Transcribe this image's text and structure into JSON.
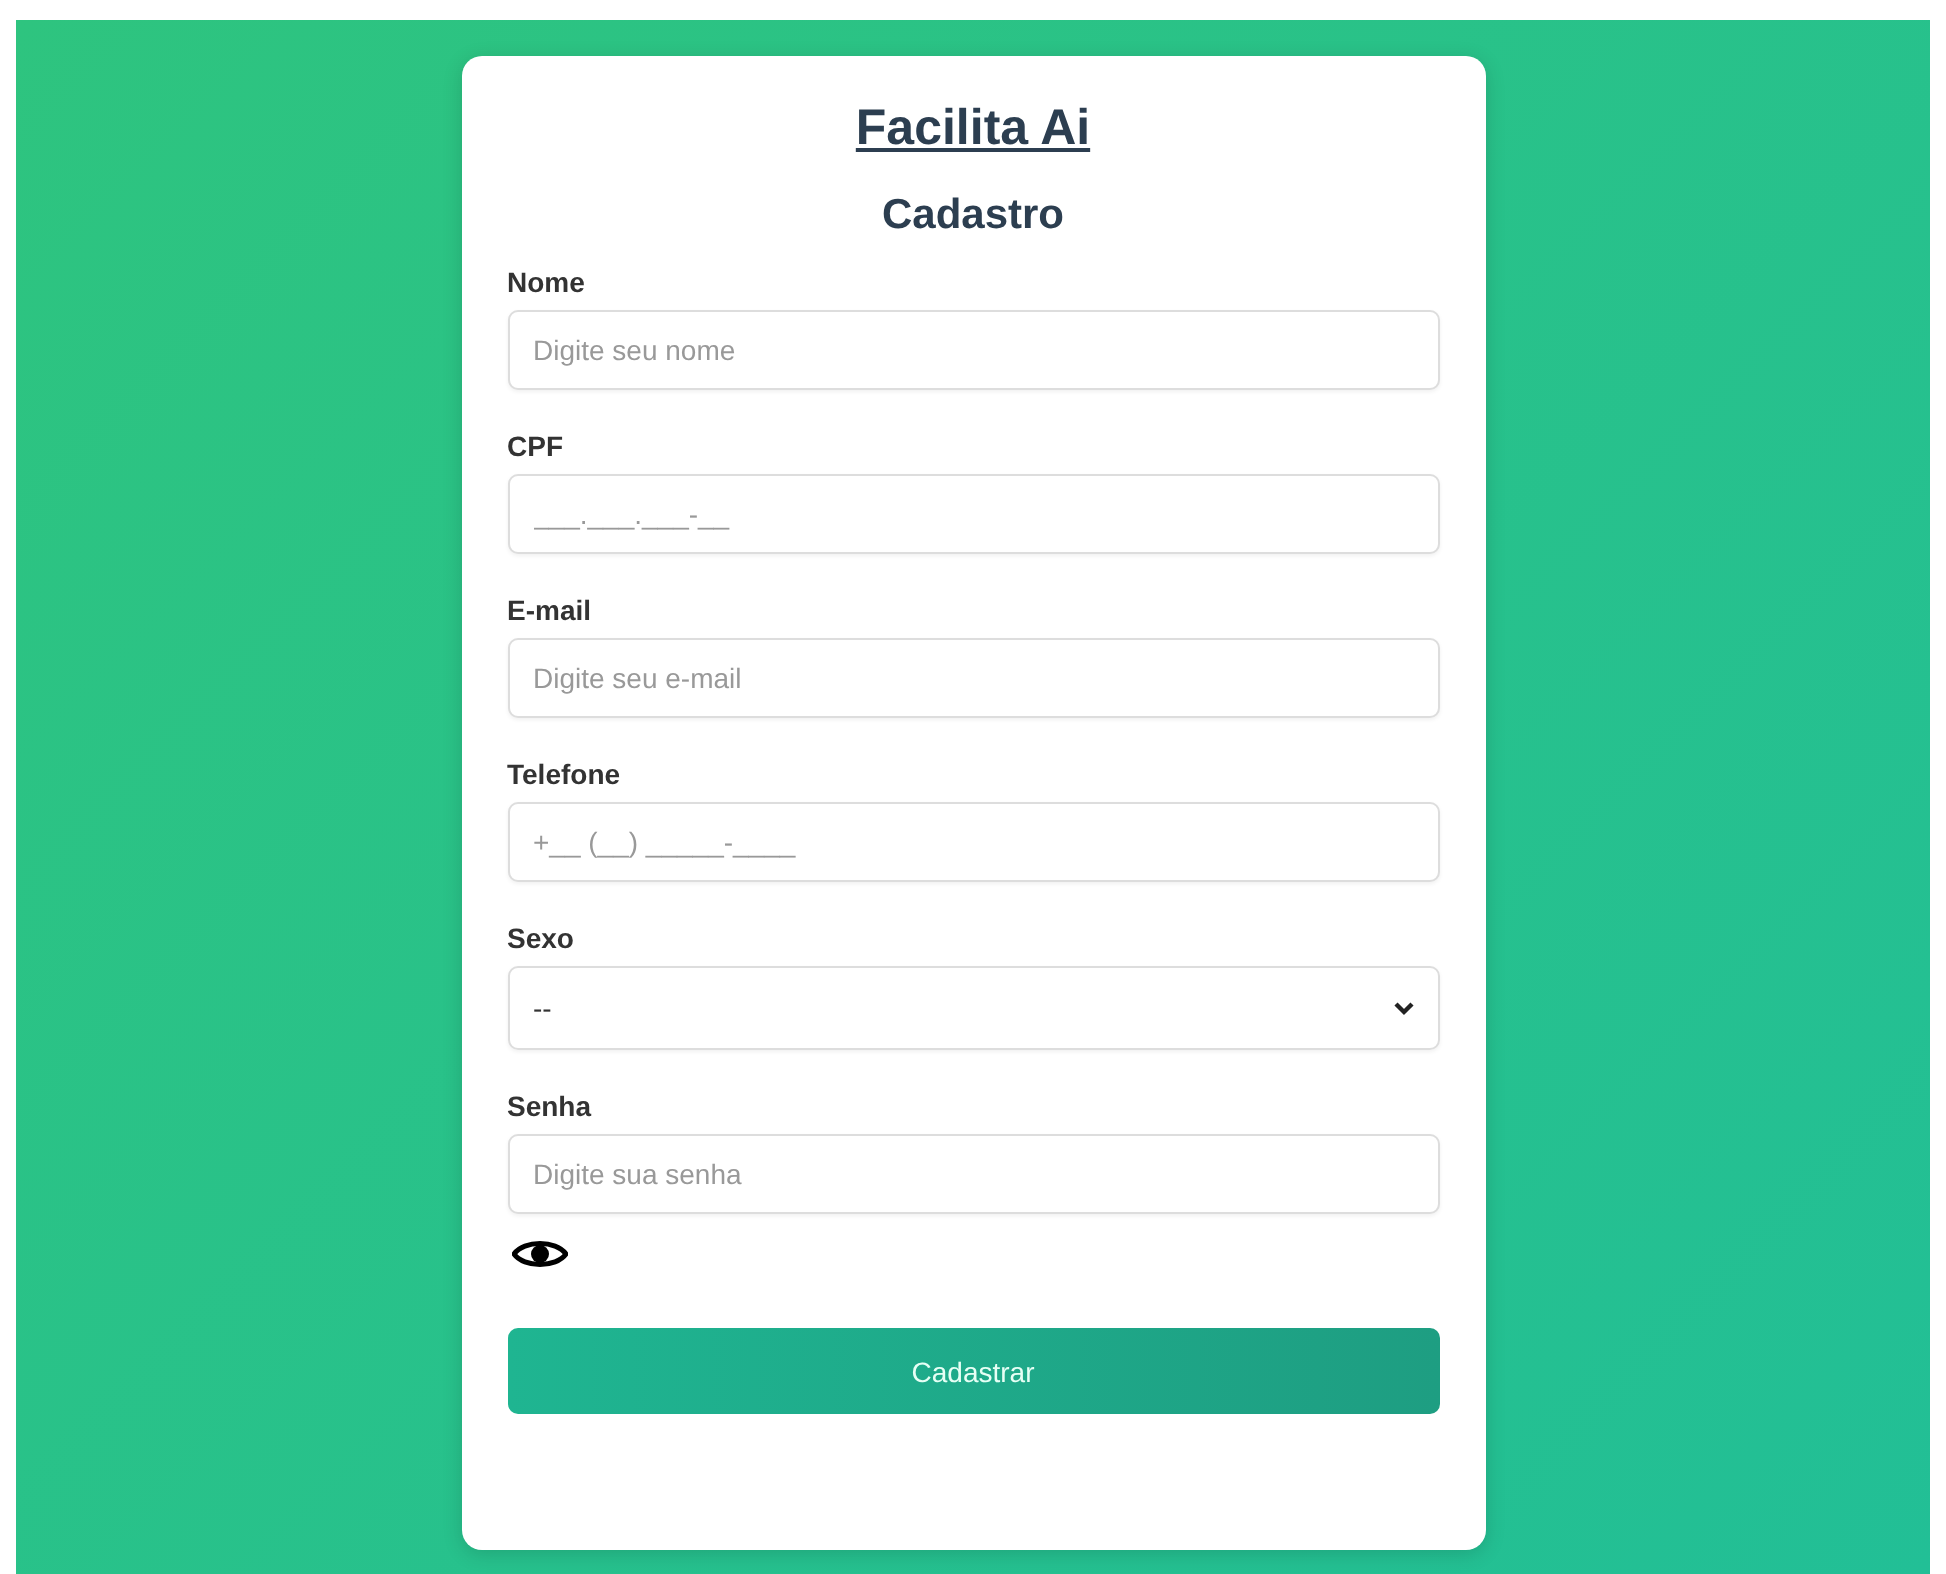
{
  "brand": "Facilita Ai",
  "title": "Cadastro",
  "fields": [
    {
      "kind": "text",
      "label": "Nome",
      "placeholder": "Digite seu nome"
    },
    {
      "kind": "text",
      "label": "CPF",
      "placeholder": "___.___.___-__"
    },
    {
      "kind": "text",
      "label": "E-mail",
      "placeholder": "Digite seu e-mail"
    },
    {
      "kind": "text",
      "label": "Telefone",
      "placeholder": "+__ (__) _____-____"
    },
    {
      "kind": "select",
      "label": "Sexo",
      "value": "--"
    },
    {
      "kind": "password",
      "label": "Senha",
      "placeholder": "Digite sua senha"
    }
  ],
  "submit": "Cadastrar"
}
